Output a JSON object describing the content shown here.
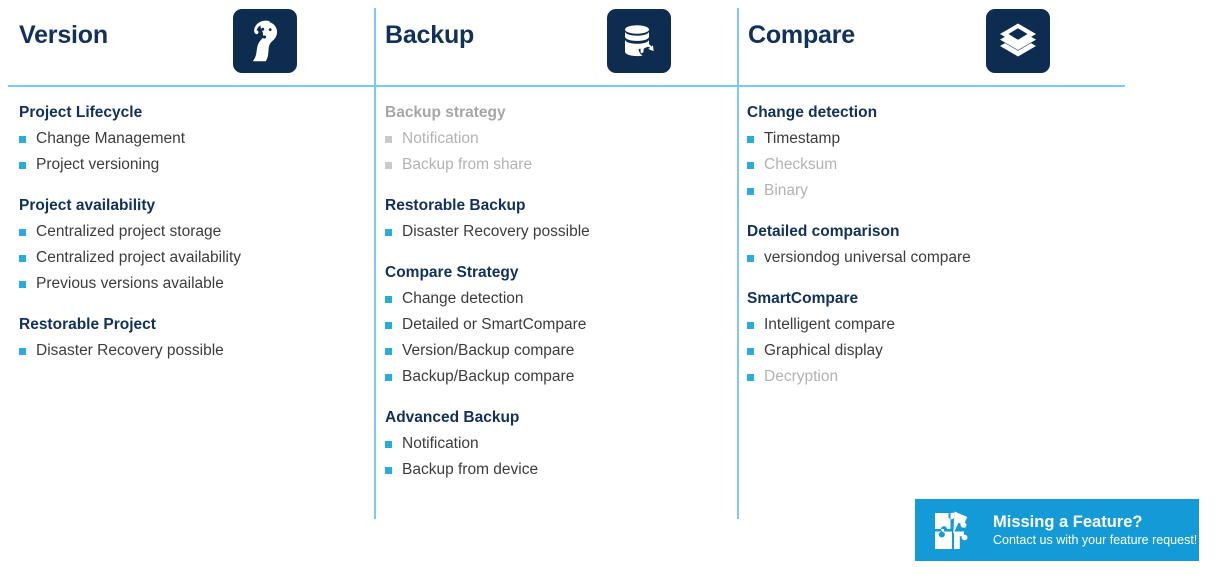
{
  "colors": {
    "navy": "#11305a",
    "icon_box": "#0d2c4f",
    "accent_blue": "#29abe2",
    "rule_blue": "#79c9f2",
    "badge_blue": "#149bd7",
    "body_text": "#3c3c3b",
    "muted_text": "#b2b2b2"
  },
  "columns": [
    {
      "title": "Version",
      "icon": "dog-head-icon",
      "groups": [
        {
          "title": "Project Lifecycle",
          "muted": false,
          "items": [
            {
              "label": "Change Management",
              "muted": false
            },
            {
              "label": "Project versioning",
              "muted": false
            }
          ]
        },
        {
          "title": "Project availability",
          "muted": false,
          "items": [
            {
              "label": "Centralized project storage",
              "muted": false
            },
            {
              "label": "Centralized project availability",
              "muted": false
            },
            {
              "label": "Previous versions available",
              "muted": false
            }
          ]
        },
        {
          "title": "Restorable Project",
          "muted": false,
          "items": [
            {
              "label": "Disaster Recovery possible",
              "muted": false
            }
          ]
        }
      ]
    },
    {
      "title": "Backup",
      "icon": "database-restore-icon",
      "groups": [
        {
          "title": "Backup strategy",
          "muted": true,
          "items": [
            {
              "label": "Notification",
              "muted": true
            },
            {
              "label": "Backup from share",
              "muted": true
            }
          ]
        },
        {
          "title": "Restorable Backup",
          "muted": false,
          "items": [
            {
              "label": "Disaster Recovery possible",
              "muted": false
            }
          ]
        },
        {
          "title": "Compare Strategy",
          "muted": false,
          "items": [
            {
              "label": "Change detection",
              "muted": false
            },
            {
              "label": "Detailed or SmartCompare",
              "muted": false
            },
            {
              "label": "Version/Backup compare",
              "muted": false
            },
            {
              "label": "Backup/Backup compare",
              "muted": false
            }
          ]
        },
        {
          "title": "Advanced Backup",
          "muted": false,
          "items": [
            {
              "label": "Notification",
              "muted": false
            },
            {
              "label": "Backup from device",
              "muted": false
            }
          ]
        }
      ]
    },
    {
      "title": "Compare",
      "icon": "layers-stack-icon",
      "groups": [
        {
          "title": "Change detection",
          "muted": false,
          "items": [
            {
              "label": "Timestamp",
              "muted": false
            },
            {
              "label": "Checksum",
              "muted": true
            },
            {
              "label": "Binary",
              "muted": true
            }
          ]
        },
        {
          "title": "Detailed comparison",
          "muted": false,
          "items": [
            {
              "label": "versiondog universal compare",
              "muted": false
            }
          ]
        },
        {
          "title": "SmartCompare",
          "muted": false,
          "items": [
            {
              "label": "Intelligent compare",
              "muted": false
            },
            {
              "label": "Graphical display",
              "muted": false
            },
            {
              "label": "Decryption",
              "muted": true
            }
          ]
        }
      ]
    }
  ],
  "feature_badge": {
    "icon": "puzzle-piece-icon",
    "title": "Missing a Feature?",
    "subtitle": "Contact us with your feature request!"
  }
}
